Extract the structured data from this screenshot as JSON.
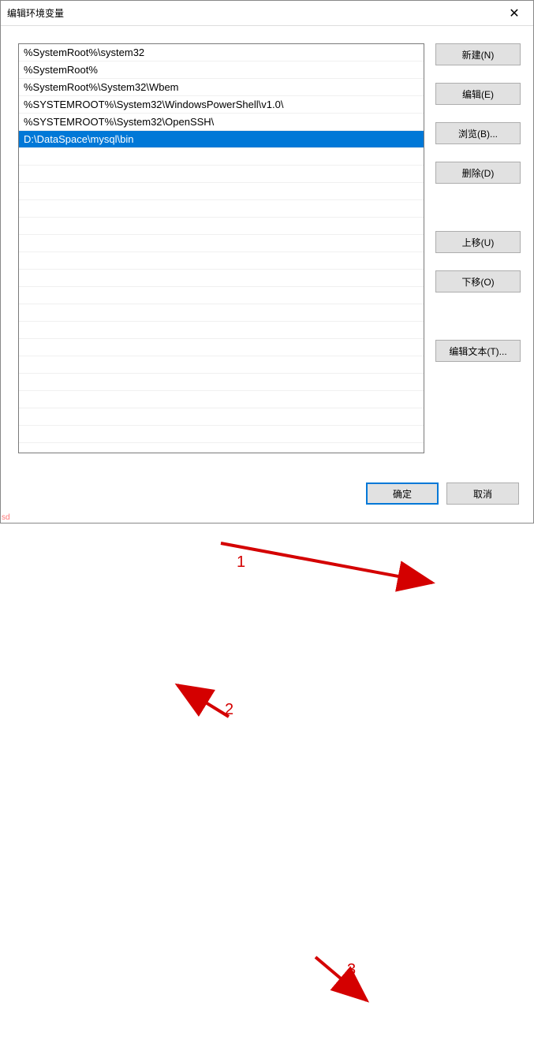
{
  "dialog": {
    "title": "编辑环境变量"
  },
  "list": {
    "items": [
      {
        "text": "%SystemRoot%\\system32",
        "selected": false
      },
      {
        "text": "%SystemRoot%",
        "selected": false
      },
      {
        "text": "%SystemRoot%\\System32\\Wbem",
        "selected": false
      },
      {
        "text": "%SYSTEMROOT%\\System32\\WindowsPowerShell\\v1.0\\",
        "selected": false
      },
      {
        "text": "%SYSTEMROOT%\\System32\\OpenSSH\\",
        "selected": false
      },
      {
        "text": "D:\\DataSpace\\mysql\\bin",
        "selected": true
      }
    ]
  },
  "buttons": {
    "new": "新建(N)",
    "edit": "编辑(E)",
    "browse": "浏览(B)...",
    "delete": "删除(D)",
    "moveUp": "上移(U)",
    "moveDown": "下移(O)",
    "editText": "编辑文本(T)...",
    "ok": "确定",
    "cancel": "取消"
  },
  "annotations": {
    "num1": "1",
    "num2": "2",
    "num3": "3"
  },
  "watermark": "sd"
}
